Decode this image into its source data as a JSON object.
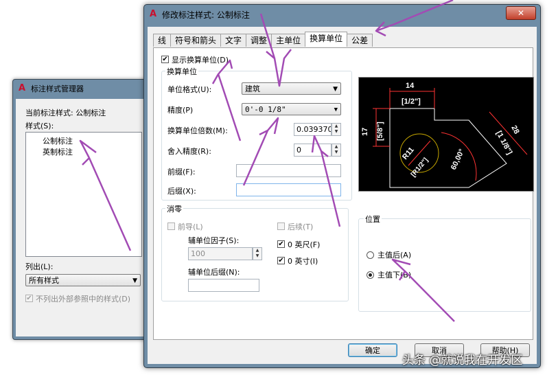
{
  "bg_dialog": {
    "title": "标注样式管理器",
    "current_style_label": "当前标注样式: 公制标注",
    "styles_label": "样式(S):",
    "styles": [
      "公制标注",
      "英制标注"
    ],
    "list_label": "列出(L):",
    "list_value": "所有样式",
    "exclude_xref_label": "不列出外部参照中的样式(D)"
  },
  "main_dialog": {
    "title": "修改标注样式: 公制标注",
    "close_label": "✕",
    "tabs": [
      "线",
      "符号和箭头",
      "文字",
      "调整",
      "主单位",
      "换算单位",
      "公差"
    ],
    "active_tab": "换算单位",
    "show_alt_units_label": "显示换算单位(D)",
    "alt_units": {
      "group_title": "换算单位",
      "unit_format_label": "单位格式(U):",
      "unit_format_value": "建筑",
      "precision_label": "精度(P)",
      "precision_value": "0'-0 1/8\"",
      "multiplier_label": "换算单位倍数(M):",
      "multiplier_value": "0.0393700",
      "round_off_label": "舍入精度(R):",
      "round_off_value": "0",
      "prefix_label": "前缀(F):",
      "prefix_value": "",
      "suffix_label": "后缀(X):",
      "suffix_value": ""
    },
    "zero_suppression": {
      "group_title": "消零",
      "leading_label": "前导(L)",
      "sub_unit_factor_label": "辅单位因子(S):",
      "sub_unit_factor_value": "100",
      "sub_unit_suffix_label": "辅单位后缀(N):",
      "sub_unit_suffix_value": "",
      "trailing_label": "后续(T)",
      "feet_label": "0 英尺(F)",
      "inches_label": "0 英寸(I)"
    },
    "placement": {
      "group_title": "位置",
      "after_primary_label": "主值后(A)",
      "below_primary_label": "主值下(B)",
      "selected": "below"
    },
    "preview": {
      "dim_top": "14",
      "dim_top_alt": "[1/2\"]",
      "dim_left": "17",
      "dim_left_alt": "[5/8\"]",
      "dim_right": "28",
      "dim_right_alt": "[1 1/8\"]",
      "radius": "R11",
      "radius_alt": "[R1/2\"]",
      "angle": "60,00°"
    },
    "buttons": {
      "ok": "确定",
      "cancel": "取消",
      "help": "帮助(H)"
    }
  },
  "watermark": "头条 @就说我在开发区",
  "colors": {
    "annotation_arrow": "#a24bb4",
    "title_bar": "#6f8da6"
  }
}
